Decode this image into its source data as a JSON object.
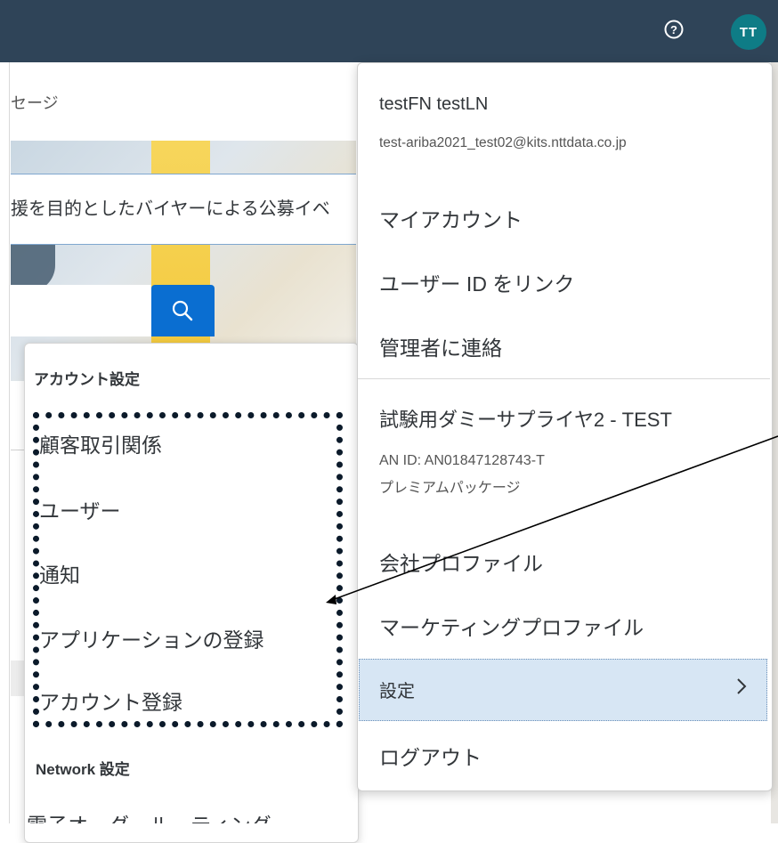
{
  "header": {
    "avatar_initials": "TT",
    "help_icon": "help-circle-icon"
  },
  "background_page": {
    "tab_label": "セージ",
    "banner_text": "援を目的としたバイヤーによる公募イベ",
    "search_icon": "search-icon"
  },
  "submenu": {
    "heading": "アカウント設定",
    "items": [
      "顧客取引関係",
      "ユーザー",
      "通知",
      "アプリケーションの登録",
      "アカウント登録"
    ],
    "network_heading": "Network 設定",
    "cut_item": "電子オーダールーティング"
  },
  "user_menu": {
    "name": "testFN testLN",
    "email": "test-ariba2021_test02@kits.nttdata.co.jp",
    "my_account": "マイアカウント",
    "link_user_id": "ユーザー ID をリンク",
    "contact_admin": "管理者に連絡",
    "company_name": "試験用ダミーサプライヤ2 - TEST",
    "an_id": "AN ID: AN01847128743-T",
    "package": "プレミアムパッケージ",
    "company_profile": "会社プロファイル",
    "marketing_profile": "マーケティングプロファイル",
    "settings": "設定",
    "logout": "ログアウト"
  },
  "colors": {
    "shellbar": "#2f4458",
    "avatar": "#0e7c86",
    "accent": "#0a6ed1",
    "selected_row": "#d7e6f4"
  }
}
